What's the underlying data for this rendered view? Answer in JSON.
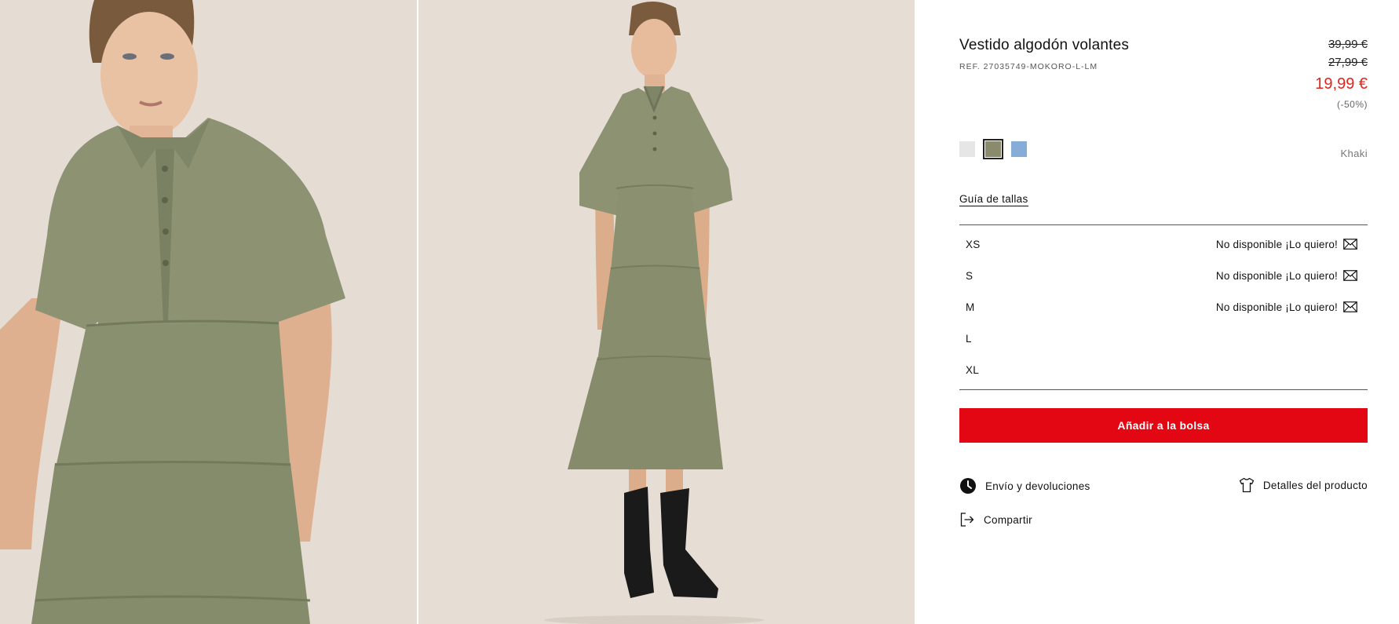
{
  "product": {
    "title": "Vestido algodón volantes",
    "ref": "REF. 27035749-MOKORO-L-LM"
  },
  "prices": {
    "original_1": "39,99 €",
    "original_2": "27,99 €",
    "current": "19,99 €",
    "discount": "(-50%)",
    "current_color": "#e1251b"
  },
  "colors": {
    "selected_name": "Khaki",
    "swatches": [
      {
        "name": "white-swatch",
        "hex": "#e6e6e6"
      },
      {
        "name": "khaki-swatch",
        "hex": "#8a8a6c",
        "selected": true
      },
      {
        "name": "blue-swatch",
        "hex": "#86acd8"
      }
    ]
  },
  "size_guide_label": "Guía de tallas",
  "sizes": [
    {
      "label": "XS",
      "status": "No disponible ¡Lo quiero!",
      "icon": "mail-icon"
    },
    {
      "label": "S",
      "status": "No disponible ¡Lo quiero!",
      "icon": "mail-icon"
    },
    {
      "label": "M",
      "status": "No disponible ¡Lo quiero!",
      "icon": "mail-icon"
    },
    {
      "label": "L",
      "status": ""
    },
    {
      "label": "XL",
      "status": ""
    }
  ],
  "add_to_bag": {
    "label": "Añadir a la bolsa",
    "color": "#e30613"
  },
  "links": {
    "shipping": {
      "label": "Envío y devoluciones",
      "icon": "clock-icon"
    },
    "details": {
      "label": "Detalles del producto",
      "icon": "tshirt-icon"
    },
    "share": {
      "label": "Compartir",
      "icon": "share-icon"
    }
  }
}
